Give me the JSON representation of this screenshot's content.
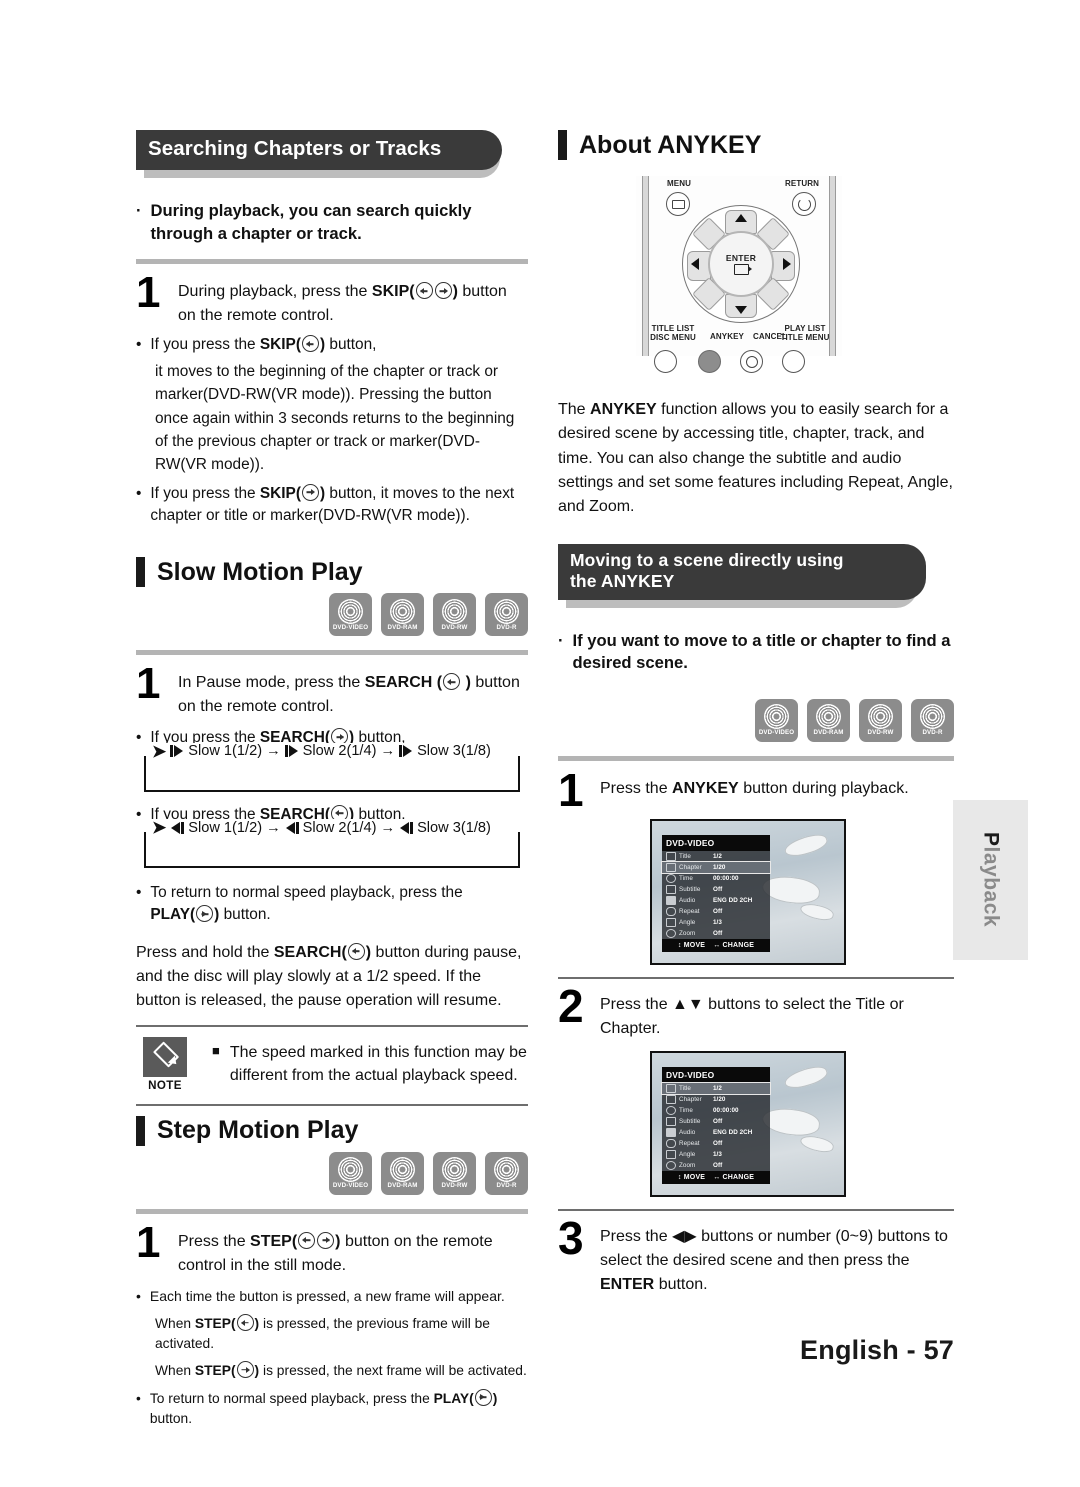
{
  "page": {
    "footer_language": "English",
    "footer_separator": "-",
    "footer_page": "57",
    "side_tab": "Playback"
  },
  "left_column": {
    "section_header": "Searching Chapters or Tracks",
    "intro_bullet": "During playback, you can search quickly through a chapter or track.",
    "step1": {
      "number": "1",
      "text_a": "During playback, press the",
      "bold_label": "SKIP",
      "paren_open": "(",
      "paren_close": ")",
      "text_b": "button on the remote control."
    },
    "bullets": [
      {
        "dot": "•",
        "lead": "If you press the",
        "label": "SKIP",
        "tail": "button,",
        "body": "it moves to the beginning of the chapter or track or marker(DVD-RW(VR mode)). Pressing the button once again within 3 seconds returns to the beginning of the previous chapter or track or marker(DVD-RW(VR mode))."
      },
      {
        "dot": "•",
        "lead": "If you press the",
        "label": "SKIP",
        "tail": "button, it moves to the next chapter or title or marker(DVD-RW(VR mode))."
      }
    ],
    "slow_motion": {
      "heading": "Slow Motion Play",
      "discs": [
        "DVD-VIDEO",
        "DVD-RAM",
        "DVD-RW",
        "DVD-R"
      ],
      "step1_number": "1",
      "step1_text_a": "In Pause mode, press the",
      "step1_label": "SEARCH",
      "step1_text_b": "button on the remote control.",
      "fwd_bullet": "If you press the",
      "fwd_label": "SEARCH",
      "fwd_tail": "button,",
      "fwd_flow": [
        "Slow 1(1/2)",
        "Slow 2(1/4)",
        "Slow 3(1/8)"
      ],
      "rev_bullet": "If you press the",
      "rev_label": "SEARCH",
      "rev_tail": "button,",
      "rev_flow": [
        "Slow 1(1/2)",
        "Slow 2(1/4)",
        "Slow 3(1/8)"
      ],
      "return_note_a": "To return to normal speed playback, press the",
      "return_label": "PLAY",
      "return_note_b": "button.",
      "hold_paragraph_a": "Press and hold the",
      "hold_label": "SEARCH",
      "hold_paragraph_b": "button during pause, and the disc will play slowly at a 1/2 speed. If the button is released, the pause operation will resume."
    },
    "note": {
      "label": "NOTE",
      "marker": "■",
      "text": "The speed marked in this function may be different from the actual playback speed."
    },
    "step_motion": {
      "heading": "Step Motion Play",
      "discs": [
        "DVD-VIDEO",
        "DVD-RAM",
        "DVD-RW",
        "DVD-R"
      ],
      "step1_number": "1",
      "step1_text_a": "Press the",
      "step1_label": "STEP",
      "step1_text_b": "button on the remote control in the still mode.",
      "bullet_each": "Each time the button is pressed, a new frame will appear.",
      "prev_line_a": "When",
      "prev_label": "STEP",
      "prev_line_b": "is pressed, the previous frame will be activated.",
      "next_line_a": "When",
      "next_label": "STEP",
      "next_line_b": "is pressed, the next frame will be activated.",
      "return_line_a": "To return to normal speed playback, press the",
      "return_label": "PLAY",
      "return_line_b": "button."
    }
  },
  "right_column": {
    "about_heading": "About ANYKEY",
    "remote": {
      "menu_label": "MENU",
      "return_label": "RETURN",
      "enter_label": "ENTER",
      "title_list_label": "TITLE LIST",
      "disc_menu_label": "DISC MENU",
      "anykey_label": "ANYKEY",
      "cancel_label": "CANCEL",
      "play_list_label": "PLAY LIST",
      "title_menu_label": "TITLE MENU"
    },
    "about_paragraph_a": "The",
    "about_paragraph_bold": "ANYKEY",
    "about_paragraph_b": "function allows you to easily search for a desired scene by accessing title, chapter, track, and time. You can also change the subtitle and audio settings and set some features including Repeat, Angle, and Zoom.",
    "moving_header": "Moving to a scene directly using the ANYKEY",
    "moving_bullet": "If you want to move to a title or chapter to find a desired scene.",
    "discs": [
      "DVD-VIDEO",
      "DVD-RAM",
      "DVD-RW",
      "DVD-R"
    ],
    "step1": {
      "number": "1",
      "text_a": "Press the",
      "bold": "ANYKEY",
      "text_b": "button during playback."
    },
    "step2": {
      "number": "2",
      "text_a": "Press the",
      "arrows": "▲▼",
      "text_b": "buttons to select the Title or Chapter."
    },
    "step3": {
      "number": "3",
      "text_a": "Press the",
      "arrows": "◀▶",
      "text_b": "buttons or number (0~9) buttons to select the desired scene and then press the",
      "bold": "ENTER",
      "text_c": "button."
    },
    "osd_1": {
      "title": "DVD-VIDEO",
      "selected": "Chapter",
      "rows": [
        {
          "name": "Title",
          "value": "1/2"
        },
        {
          "name": "Chapter",
          "value": "1/20"
        },
        {
          "name": "Time",
          "value": "00:00:00"
        },
        {
          "name": "Subtitle",
          "value": "Off"
        },
        {
          "name": "Audio",
          "value": "ENG DD 2CH"
        },
        {
          "name": "Repeat",
          "value": "Off"
        },
        {
          "name": "Angle",
          "value": "1/3"
        },
        {
          "name": "Zoom",
          "value": "Off"
        }
      ],
      "footer_move": "MOVE",
      "footer_change": "CHANGE",
      "footer_move_icon": "↕",
      "footer_change_icon": "↔"
    },
    "osd_2": {
      "title": "DVD-VIDEO",
      "selected": "Title",
      "rows": [
        {
          "name": "Title",
          "value": "1/2"
        },
        {
          "name": "Chapter",
          "value": "1/20"
        },
        {
          "name": "Time",
          "value": "00:00:00"
        },
        {
          "name": "Subtitle",
          "value": "Off"
        },
        {
          "name": "Audio",
          "value": "ENG DD 2CH"
        },
        {
          "name": "Repeat",
          "value": "Off"
        },
        {
          "name": "Angle",
          "value": "1/3"
        },
        {
          "name": "Zoom",
          "value": "Off"
        }
      ],
      "footer_move": "MOVE",
      "footer_change": "CHANGE",
      "footer_move_icon": "↕",
      "footer_change_icon": "↔"
    }
  }
}
